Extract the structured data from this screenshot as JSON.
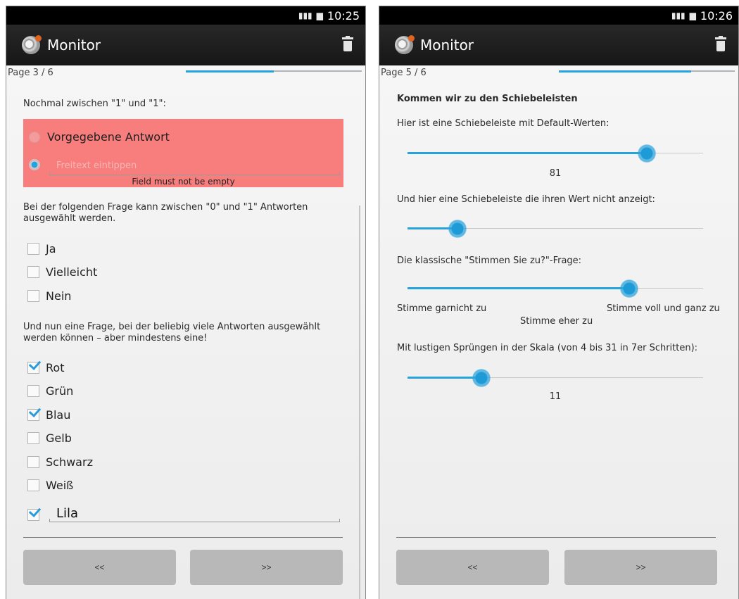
{
  "left": {
    "status": {
      "time": "10:25",
      "network": "3G"
    },
    "app_title": "Monitor",
    "page_label": "Page 3 / 6",
    "progress": 0.5,
    "q1": "Nochmal zwischen \"1\" und \"1\":",
    "radio_options": [
      {
        "label": "Vorgegebene Antwort",
        "selected": false
      },
      {
        "placeholder": "Freitext eintippen",
        "selected": true
      }
    ],
    "error_message": "Field must not be empty",
    "q2": "Bei der folgenden Frage kann zwischen \"0\" und \"1\" Antworten ausgewählt werden.",
    "q2_options": [
      {
        "label": "Ja",
        "checked": false
      },
      {
        "label": "Vielleicht",
        "checked": false
      },
      {
        "label": "Nein",
        "checked": false
      }
    ],
    "q3": "Und nun eine Frage, bei der beliebig viele Antworten ausgewählt werden können – aber mindestens eine!",
    "q3_options": [
      {
        "label": "Rot",
        "checked": true
      },
      {
        "label": "Grün",
        "checked": false
      },
      {
        "label": "Blau",
        "checked": true
      },
      {
        "label": "Gelb",
        "checked": false
      },
      {
        "label": "Schwarz",
        "checked": false
      },
      {
        "label": "Weiß",
        "checked": false
      }
    ],
    "q3_freetext": {
      "value": "Lila",
      "checked": true
    },
    "prev_label": "<<",
    "next_label": ">>"
  },
  "right": {
    "status": {
      "time": "10:26",
      "network": "3G"
    },
    "app_title": "Monitor",
    "page_label": "Page 5 / 6",
    "progress": 0.75,
    "heading": "Kommen wir zu den Schiebeleisten",
    "s1_question": "Hier ist eine Schiebeleiste mit Default-Werten:",
    "s1": {
      "value": 81,
      "min": 0,
      "max": 100,
      "value_label": "81"
    },
    "s2_question": "Und hier eine Schiebeleiste die ihren Wert nicht anzeigt:",
    "s2": {
      "fraction": 0.17
    },
    "s3_question": "Die klassische \"Stimmen Sie zu?\"-Frage:",
    "s3": {
      "fraction": 0.75
    },
    "s3_labels": {
      "low": "Stimme garnicht zu",
      "mid": "Stimme eher zu",
      "high": "Stimme voll und ganz zu"
    },
    "s4_question": "Mit lustigen Sprüngen in der Skala (von 4 bis 31 in 7er Schritten):",
    "s4": {
      "value": 11,
      "min": 4,
      "max": 32,
      "value_label": "11"
    },
    "prev_label": "<<",
    "next_label": ">>"
  },
  "colors": {
    "accent": "#27a3dc",
    "error_bg": "#f87e7e",
    "actionbar": "#1f1f1f",
    "button": "#b8b8b8"
  }
}
